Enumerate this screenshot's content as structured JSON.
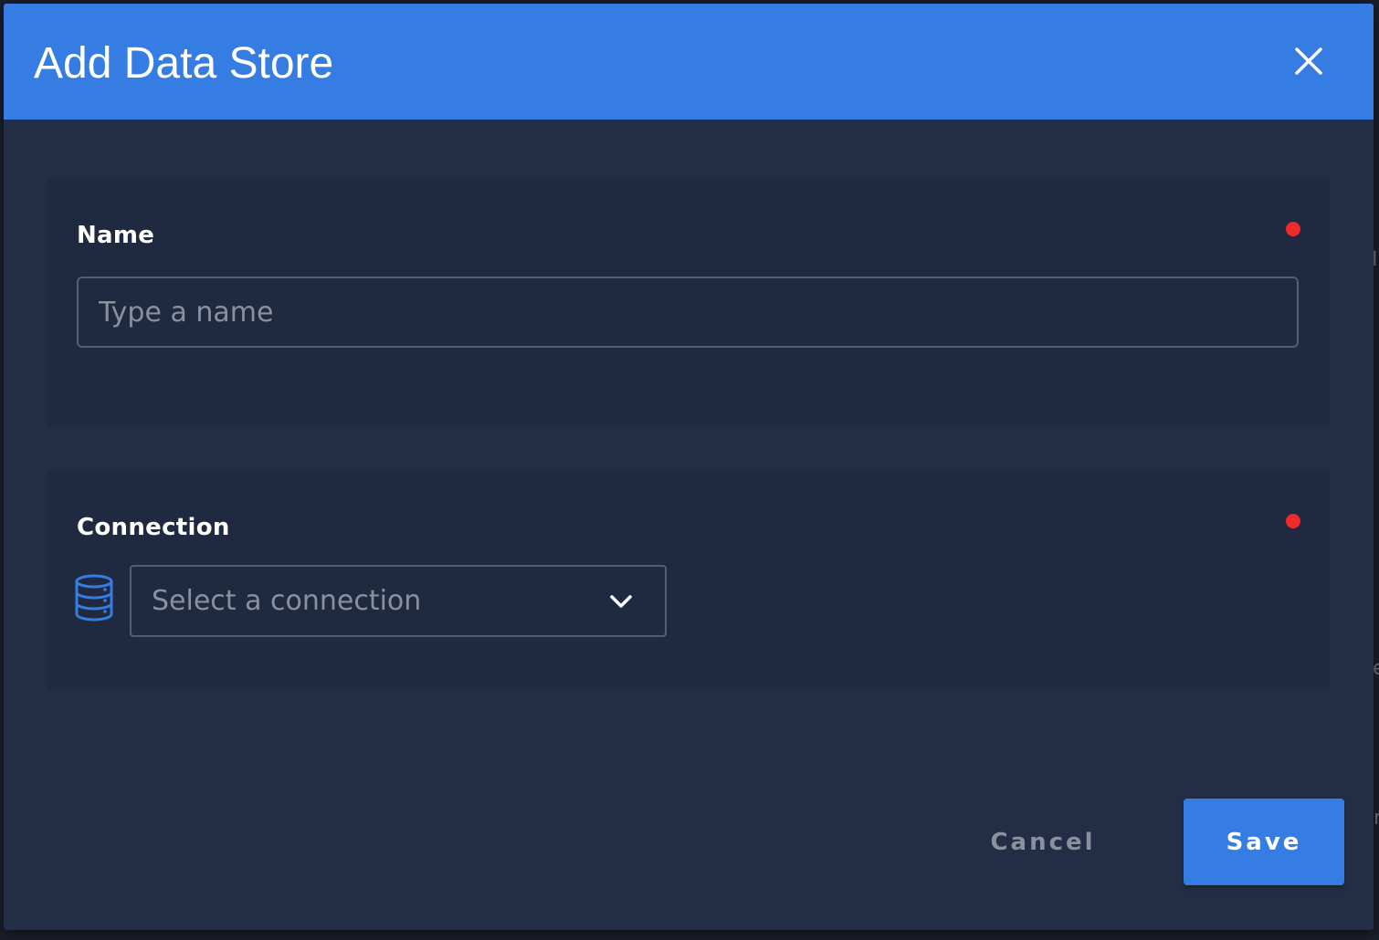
{
  "dialog": {
    "title": "Add Data Store",
    "close_icon": "close-icon"
  },
  "form": {
    "name": {
      "label": "Name",
      "placeholder": "Type a name",
      "value": "",
      "required": true
    },
    "connection": {
      "label": "Connection",
      "placeholder": "Select a connection",
      "icon": "database-icon",
      "dropdown_icon": "chevron-down-icon",
      "required": true
    }
  },
  "footer": {
    "cancel_label": "Cancel",
    "save_label": "Save"
  },
  "colors": {
    "header": "#367de3",
    "dialog_bg": "#232d45",
    "section_bg": "#1f2940",
    "required_dot": "#f02a2a",
    "primary_button": "#367de3"
  }
}
